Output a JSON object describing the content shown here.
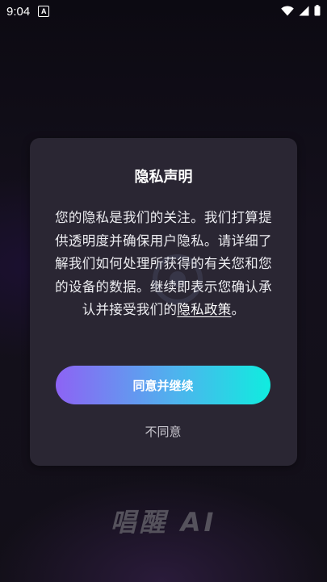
{
  "status_bar": {
    "time": "9:04",
    "notification_icon_letter": "A",
    "icons": [
      "wifi-icon",
      "signal-icon",
      "battery-icon"
    ]
  },
  "dialog": {
    "title": "隐私声明",
    "body_text": "您的隐私是我们的关注。我们打算提供透明度并确保用户隐私。请详细了解我们如何处理所获得的有关您和您的设备的数据。继续即表示您确认承认并接受我们的",
    "policy_link": "隐私政策",
    "body_end": "。",
    "agree_label": "同意并继续",
    "disagree_label": "不同意"
  },
  "app": {
    "logo_text": "唱醒 AI"
  },
  "colors": {
    "dialog_bg": "#2a2633",
    "button_gradient_start": "#8d63f4",
    "button_gradient_end": "#10ecdf",
    "page_bg": "#120f18"
  }
}
